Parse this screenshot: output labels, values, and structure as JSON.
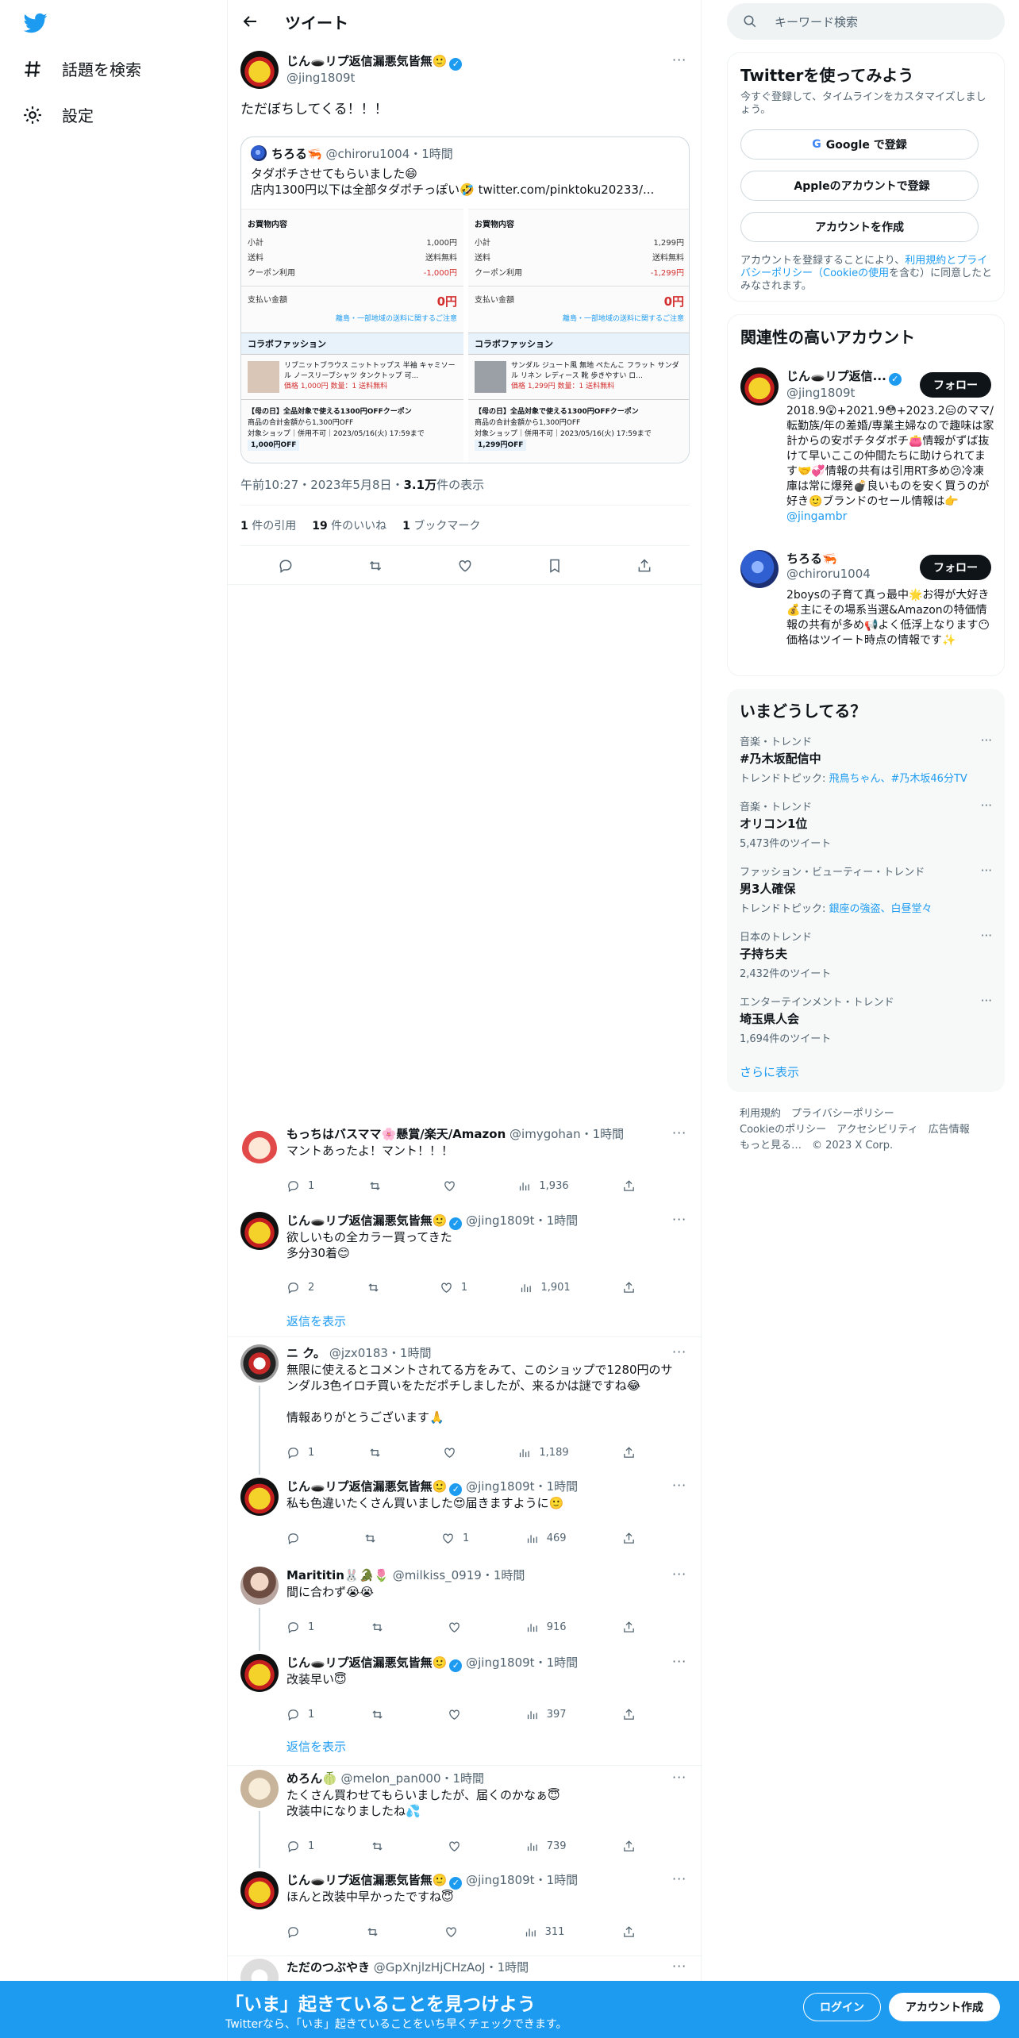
{
  "sidebar": {
    "explore_label": "話題を検索",
    "settings_label": "設定"
  },
  "header": {
    "title": "ツイート"
  },
  "tweet": {
    "name": "じん🕳️リプ返信漏悪気皆無🙂",
    "handle": "@jing1809t",
    "text": "ただぼちしてくる！！！",
    "time": "午前10:27・2023年5月8日・",
    "views": "3.1万",
    "views_label": "件の表示",
    "quotes": "1",
    "quotes_label": "件の引用",
    "likes": "19",
    "likes_label": "件のいいね",
    "bookmarks": "1",
    "bookmarks_label": "ブックマーク"
  },
  "quote": {
    "name": "ちろる🦐",
    "handle": "@chiroru1004",
    "time": "・1時間",
    "line1": "タダポチさせてもらいました😄",
    "line2": "店内1300円以下は全部タダポチっぽい🤣 twitter.com/pinktoku20233/...",
    "left": {
      "title": "お買物内容",
      "rows": [
        [
          "小計",
          "1,000円"
        ],
        [
          "送料",
          "送料無料"
        ],
        [
          "クーポン利用",
          "-1,000円"
        ]
      ],
      "total_label": "支払い金額",
      "total": "0円",
      "note": "離島・一部地域の送料に関するご注意",
      "shop": "コラボファッション",
      "item": "リブニットブラウス ニットトップス 半袖 キャミソール ノースリーブシャツ タンクトップ 可...",
      "price": "価格 1,000円  数量：1  送料無料",
      "coupon": "【母の日】全品対象で使える1300円OFFクーポン",
      "coupon_sub": "商品の合計金額から1,300円OFF",
      "coupon_term": "対象ショップ｜併用不可｜2023/05/16(火) 17:59まで",
      "coupon_badge": "1,000円OFF"
    },
    "right": {
      "title": "お買物内容",
      "rows": [
        [
          "小計",
          "1,299円"
        ],
        [
          "送料",
          "送料無料"
        ],
        [
          "クーポン利用",
          "-1,299円"
        ]
      ],
      "total_label": "支払い金額",
      "total": "0円",
      "note": "離島・一部地域の送料に関するご注意",
      "shop": "コラボファッション",
      "item": "サンダル ジュート風 無地 ぺたんこ フラット サンダル リネン レディース 靴 歩きやすい ロ...",
      "price": "価格 1,299円  数量：1  送料無料",
      "coupon": "【母の日】全品対象で使える1300円OFFクーポン",
      "coupon_sub": "商品の合計金額から1,300円OFF",
      "coupon_term": "対象ショップ｜併用不可｜2023/05/16(火) 17:59まで",
      "coupon_badge": "1,299円OFF"
    }
  },
  "replies": [
    {
      "name": "もっちはバスママ🌸懸賞/楽天/Amazon",
      "handle": "@imygohan",
      "time": "・1時間",
      "text": "マントあったよ！マント！！！",
      "reply": "1",
      "retweet": "",
      "like": "",
      "views": "1,936"
    },
    {
      "name": "じん🕳️リプ返信漏悪気皆無🙂",
      "handle": "@jing1809t",
      "time": "・1時間",
      "text": "欲しいもの全カラー買ってきた\n多分30着😊",
      "reply": "2",
      "retweet": "",
      "like": "1",
      "views": "1,901"
    },
    {
      "name": "ニ ク。",
      "handle": "@jzx0183",
      "time": "・1時間",
      "text": "無限に使えるとコメントされてる方をみて、このショップで1280円のサンダル3色イロチ買いをただポチしましたが、来るかは謎ですね😂\n\n情報ありがとうございます🙏",
      "reply": "1",
      "retweet": "",
      "like": "",
      "views": "1,189"
    },
    {
      "name": "じん🕳️リプ返信漏悪気皆無🙂",
      "handle": "@jing1809t",
      "time": "・1時間",
      "text": "私も色違いたくさん買いました😍届きますように🙂",
      "reply": "",
      "retweet": "",
      "like": "1",
      "views": "469"
    },
    {
      "name": "Marititin🐰🐊🌷",
      "handle": "@milkiss_0919",
      "time": "・1時間",
      "text": "間に合わず😭😭",
      "reply": "1",
      "retweet": "",
      "like": "",
      "views": "916"
    },
    {
      "name": "じん🕳️リプ返信漏悪気皆無🙂",
      "handle": "@jing1809t",
      "time": "・1時間",
      "text": "改装早い😇",
      "reply": "1",
      "retweet": "",
      "like": "",
      "views": "397"
    },
    {
      "name": "めろん🍈",
      "handle": "@melon_pan000",
      "time": "・1時間",
      "text": "たくさん買わせてもらいましたが、届くのかなぁ😇\n改装中になりましたね💦",
      "reply": "1",
      "retweet": "",
      "like": "",
      "views": "739"
    },
    {
      "name": "じん🕳️リプ返信漏悪気皆無🙂",
      "handle": "@jing1809t",
      "time": "・1時間",
      "text": "ほんと改装中早かったですね😇",
      "reply": "",
      "retweet": "",
      "like": "",
      "views": "311"
    },
    {
      "name": "ただのつぶやき",
      "handle": "@GpXnjlzHjCHzAoJ",
      "time": "・1時間",
      "text": "",
      "reply": "",
      "retweet": "",
      "like": "",
      "views": ""
    }
  ],
  "show_replies": "返信を表示",
  "right": {
    "search_placeholder": "キーワード検索",
    "signup_box": {
      "title": "Twitterを使ってみよう",
      "subtitle": "今すぐ登録して、タイムラインをカスタマイズしましょう。",
      "google": "Google で登録",
      "apple": "Appleのアカウントで登録",
      "create": "アカウントを作成",
      "terms_pre": "アカウントを登録することにより、",
      "terms_link": "利用規約とプライバシーポリシー（Cookieの使用",
      "terms_post": "を含む）に同意したとみなされます。"
    },
    "related": {
      "title": "関連性の高いアカウント",
      "follow": "フォロー",
      "accounts": [
        {
          "name": "じん🕳️リプ返信...",
          "handle": "@jing1809t",
          "bio": "2018.9😲+2021.9😳+2023.2😑のママ/転勤族/年の差婚/専業主婦なので趣味は家計からの安ポチタダポチ👛情報がずば抜けて早いここの仲間たちに助けられてます🤝💞情報の共有は引用RT多め😕冷凍庫は常に爆発💣良いものを安く買うのが好き🙂ブランドのセール情報は👉",
          "bio_link": "@jingambr"
        },
        {
          "name": "ちろる🦐",
          "handle": "@chiroru1004",
          "bio": "2boysの子育て真っ最中🌟お得が大好き💰主にその場系当選&Amazonの特価情報の共有が多め📢よく低浮上なります😶価格はツイート時点の情報です✨",
          "bio_link": ""
        }
      ]
    },
    "trends": {
      "title": "いまどうしてる？",
      "items": [
        {
          "cat": "音楽・トレンド",
          "name": "#乃木坂配信中",
          "sub_label": "トレンドトピック: ",
          "sub_link": "飛鳥ちゃん、#乃木坂46分TV"
        },
        {
          "cat": "音楽・トレンド",
          "name": "オリコン1位",
          "sub_label": "5,473件のツイート",
          "sub_link": ""
        },
        {
          "cat": "ファッション・ビューティー・トレンド",
          "name": "男3人確保",
          "sub_label": "トレンドトピック: ",
          "sub_link": "銀座の強盗、白昼堂々"
        },
        {
          "cat": "日本のトレンド",
          "name": "子持ち夫",
          "sub_label": "2,432件のツイート",
          "sub_link": ""
        },
        {
          "cat": "エンターテインメント・トレンド",
          "name": "埼玉県人会",
          "sub_label": "1,694件のツイート",
          "sub_link": ""
        }
      ],
      "show_more": "さらに表示"
    },
    "footer": {
      "line1": "利用規約　プライバシーポリシー",
      "line2": "Cookieのポリシー　アクセシビリティ　広告情報",
      "line3": "もっと見る…　© 2023 X Corp."
    }
  },
  "bottom": {
    "title": "「いま」起きていることを見つけよう",
    "subtitle": "Twitterなら、「いま」起きていることをいち早くチェックできます。",
    "login": "ログイン",
    "signup": "アカウント作成"
  },
  "colors": {
    "accent": "#1d9bf0",
    "text": "#0f1419",
    "muted": "#536471"
  }
}
